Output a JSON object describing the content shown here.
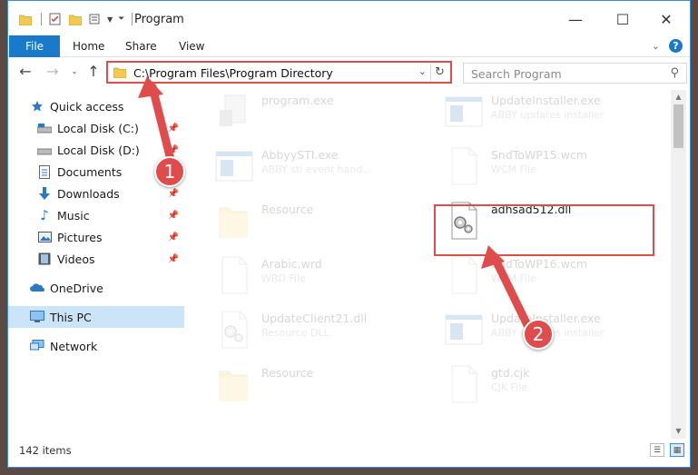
{
  "window": {
    "title": "Program",
    "minimize": "—",
    "maximize": "☐",
    "close": "✕"
  },
  "ribbon": {
    "tabs": [
      "File",
      "Home",
      "Share",
      "View"
    ],
    "expand_icon": "chevron-down-icon",
    "help": "?"
  },
  "address": {
    "path": "C:\\Program Files\\Program Directory",
    "search_placeholder": "Search Program"
  },
  "navigation": {
    "quick_access": "Quick access",
    "items": [
      {
        "label": "Local Disk (C:)",
        "pinned": true
      },
      {
        "label": "Local Disk (D:)",
        "pinned": true
      },
      {
        "label": "Documents",
        "pinned": true
      },
      {
        "label": "Downloads",
        "pinned": true
      },
      {
        "label": "Music",
        "pinned": true
      },
      {
        "label": "Pictures",
        "pinned": true
      },
      {
        "label": "Videos",
        "pinned": true
      }
    ],
    "onedrive": "OneDrive",
    "this_pc": "This PC",
    "network": "Network"
  },
  "files": [
    {
      "name": "program.exe",
      "type": "",
      "icon": "exe",
      "col": 0,
      "row": 0,
      "faded": true
    },
    {
      "name": "UpdateInstaller.exe",
      "type": "ABBY updates installer",
      "icon": "window",
      "col": 1,
      "row": 0,
      "faded": true
    },
    {
      "name": "AbbyySTI.exe",
      "type": "ABBY sti event hand...",
      "icon": "window",
      "col": 0,
      "row": 1,
      "faded": true
    },
    {
      "name": "SndToWP15.wcm",
      "type": "WCM File",
      "icon": "doc",
      "col": 1,
      "row": 1,
      "faded": true
    },
    {
      "name": "Resource",
      "type": "",
      "icon": "folder",
      "col": 0,
      "row": 2,
      "faded": true
    },
    {
      "name": "adhsad512.dll",
      "type": "",
      "icon": "dll",
      "col": 1,
      "row": 2,
      "faded": false
    },
    {
      "name": "Arabic.wrd",
      "type": "WRD File",
      "icon": "doc",
      "col": 0,
      "row": 3,
      "faded": true
    },
    {
      "name": "SndToWP16.wcm",
      "type": "WCM File",
      "icon": "doc",
      "col": 1,
      "row": 3,
      "faded": true
    },
    {
      "name": "UpdateClient21.dll",
      "type": "Resource DLL",
      "icon": "dll",
      "col": 0,
      "row": 4,
      "faded": true
    },
    {
      "name": "UpdateInstaller.exe",
      "type": "ABBY updates installer",
      "icon": "window",
      "col": 1,
      "row": 4,
      "faded": true
    },
    {
      "name": "Resource",
      "type": "",
      "icon": "folder",
      "col": 0,
      "row": 5,
      "faded": true
    },
    {
      "name": "gtd.cjk",
      "type": "CJK File",
      "icon": "doc",
      "col": 1,
      "row": 5,
      "faded": true
    }
  ],
  "status": {
    "item_count": "142 items"
  },
  "annotations": {
    "step1": "1",
    "step2": "2",
    "color": "#e04c4c"
  }
}
